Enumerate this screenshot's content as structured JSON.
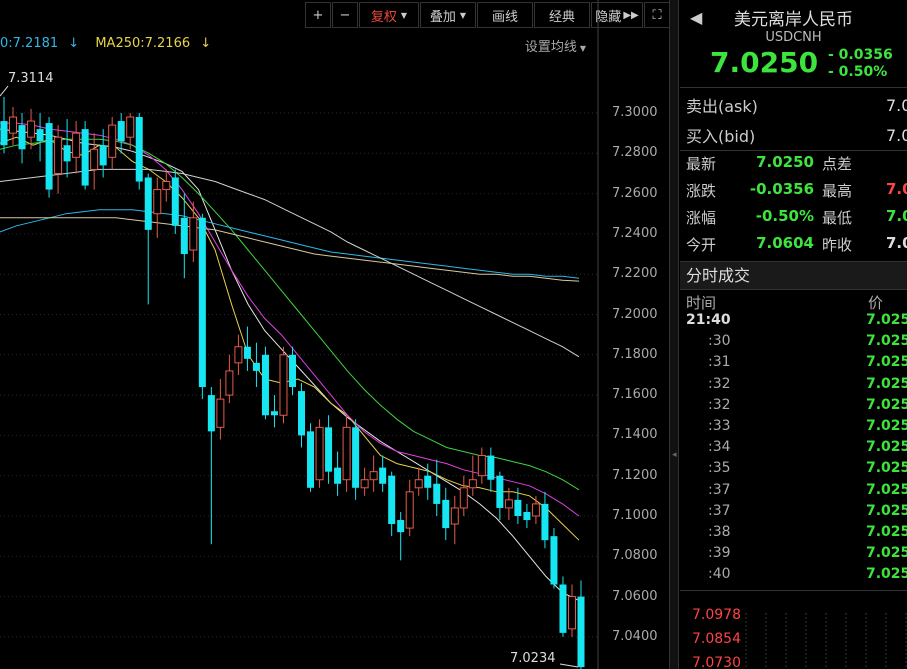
{
  "toolbar": {
    "zoom_in": "+",
    "zoom_out": "−",
    "restore_rights": "复权",
    "overlay": "叠加",
    "draw_line": "画线",
    "classic": "经典",
    "hide": "隐藏",
    "fullscreen_icon": "fullscreen-icon"
  },
  "ma_legend": {
    "partial": "0:7.2181",
    "ma250": "MA250:7.2166"
  },
  "ma_settings": "设置均线",
  "annotations": {
    "high_label": "7.3114",
    "low_label": "7.0234"
  },
  "price_axis": [
    "7.3000",
    "7.2800",
    "7.2600",
    "7.2400",
    "7.2200",
    "7.2000",
    "7.1800",
    "7.1600",
    "7.1400",
    "7.1200",
    "7.1000",
    "7.0800",
    "7.0600",
    "7.0400"
  ],
  "quote": {
    "name": "美元离岸人民币",
    "code": "USDCNH",
    "price": "7.0250",
    "change": "- 0.0356",
    "change_pct": "- 0.50%"
  },
  "askbid": {
    "ask_label": "卖出(ask)",
    "ask_value": "7.0",
    "bid_label": "买入(bid)",
    "bid_value": "7.0"
  },
  "stats": [
    {
      "label": "最新",
      "value": "7.0250",
      "label2": "点差",
      "value2": ""
    },
    {
      "label": "涨跌",
      "value": "-0.0356",
      "label2": "最高",
      "value2": "7.0"
    },
    {
      "label": "涨幅",
      "value": "-0.50%",
      "label2": "最低",
      "value2": "7.0"
    },
    {
      "label": "今开",
      "value": "7.0604",
      "label2": "昨收",
      "value2": "7.0"
    }
  ],
  "ticks": {
    "title": "分时成交",
    "col_time": "时间",
    "col_price": "价",
    "rows": [
      {
        "time": "21:40",
        "price": "7.025"
      },
      {
        "time": ":30",
        "price": "7.025"
      },
      {
        "time": ":31",
        "price": "7.025"
      },
      {
        "time": ":32",
        "price": "7.025"
      },
      {
        "time": ":32",
        "price": "7.025"
      },
      {
        "time": ":33",
        "price": "7.025"
      },
      {
        "time": ":34",
        "price": "7.025"
      },
      {
        "time": ":35",
        "price": "7.025"
      },
      {
        "time": ":37",
        "price": "7.025"
      },
      {
        "time": ":37",
        "price": "7.025"
      },
      {
        "time": ":38",
        "price": "7.025"
      },
      {
        "time": ":39",
        "price": "7.025"
      },
      {
        "time": ":40",
        "price": "7.025"
      }
    ]
  },
  "depth": [
    "7.0978",
    "7.0854",
    "7.0730"
  ],
  "chart_data": {
    "type": "candlestick",
    "y_range": [
      7.0234,
      7.3114
    ],
    "colors": {
      "up": "#e55b4b",
      "down": "#16e6f2",
      "ma_white": "#e6e6e6",
      "ma_yellow": "#e6d34a",
      "ma_magenta": "#e040e0",
      "ma_green": "#3fd33f",
      "ma_cyan": "#2fb7e8",
      "ma_pale": "#d8c8a0"
    },
    "candles": [
      {
        "o": 7.296,
        "c": 7.284,
        "h": 7.308,
        "l": 7.28
      },
      {
        "o": 7.29,
        "c": 7.298,
        "h": 7.303,
        "l": 7.284
      },
      {
        "o": 7.294,
        "c": 7.282,
        "h": 7.3,
        "l": 7.275
      },
      {
        "o": 7.288,
        "c": 7.296,
        "h": 7.302,
        "l": 7.282
      },
      {
        "o": 7.292,
        "c": 7.286,
        "h": 7.3,
        "l": 7.276
      },
      {
        "o": 7.295,
        "c": 7.262,
        "h": 7.298,
        "l": 7.258
      },
      {
        "o": 7.27,
        "c": 7.288,
        "h": 7.294,
        "l": 7.26
      },
      {
        "o": 7.284,
        "c": 7.276,
        "h": 7.297,
        "l": 7.268
      },
      {
        "o": 7.278,
        "c": 7.29,
        "h": 7.296,
        "l": 7.27
      },
      {
        "o": 7.292,
        "c": 7.264,
        "h": 7.296,
        "l": 7.262
      },
      {
        "o": 7.272,
        "c": 7.282,
        "h": 7.29,
        "l": 7.262
      },
      {
        "o": 7.284,
        "c": 7.274,
        "h": 7.292,
        "l": 7.268
      },
      {
        "o": 7.278,
        "c": 7.294,
        "h": 7.298,
        "l": 7.272
      },
      {
        "o": 7.296,
        "c": 7.286,
        "h": 7.3,
        "l": 7.28
      },
      {
        "o": 7.288,
        "c": 7.298,
        "h": 7.3,
        "l": 7.282
      },
      {
        "o": 7.298,
        "c": 7.266,
        "h": 7.3,
        "l": 7.262
      },
      {
        "o": 7.268,
        "c": 7.242,
        "h": 7.27,
        "l": 7.205
      },
      {
        "o": 7.25,
        "c": 7.262,
        "h": 7.268,
        "l": 7.238
      },
      {
        "o": 7.262,
        "c": 7.266,
        "h": 7.272,
        "l": 7.256
      },
      {
        "o": 7.268,
        "c": 7.244,
        "h": 7.272,
        "l": 7.24
      },
      {
        "o": 7.248,
        "c": 7.23,
        "h": 7.26,
        "l": 7.218
      },
      {
        "o": 7.232,
        "c": 7.248,
        "h": 7.256,
        "l": 7.226
      },
      {
        "o": 7.248,
        "c": 7.164,
        "h": 7.25,
        "l": 7.158
      },
      {
        "o": 7.16,
        "c": 7.142,
        "h": 7.164,
        "l": 7.086
      },
      {
        "o": 7.144,
        "c": 7.158,
        "h": 7.168,
        "l": 7.138
      },
      {
        "o": 7.16,
        "c": 7.172,
        "h": 7.18,
        "l": 7.156
      },
      {
        "o": 7.176,
        "c": 7.184,
        "h": 7.19,
        "l": 7.17
      },
      {
        "o": 7.184,
        "c": 7.178,
        "h": 7.194,
        "l": 7.172
      },
      {
        "o": 7.176,
        "c": 7.172,
        "h": 7.186,
        "l": 7.164
      },
      {
        "o": 7.18,
        "c": 7.15,
        "h": 7.184,
        "l": 7.148
      },
      {
        "o": 7.152,
        "c": 7.15,
        "h": 7.16,
        "l": 7.144
      },
      {
        "o": 7.15,
        "c": 7.18,
        "h": 7.184,
        "l": 7.146
      },
      {
        "o": 7.18,
        "c": 7.164,
        "h": 7.184,
        "l": 7.16
      },
      {
        "o": 7.162,
        "c": 7.14,
        "h": 7.166,
        "l": 7.134
      },
      {
        "o": 7.142,
        "c": 7.114,
        "h": 7.146,
        "l": 7.112
      },
      {
        "o": 7.118,
        "c": 7.144,
        "h": 7.148,
        "l": 7.114
      },
      {
        "o": 7.144,
        "c": 7.122,
        "h": 7.15,
        "l": 7.116
      },
      {
        "o": 7.124,
        "c": 7.116,
        "h": 7.132,
        "l": 7.11
      },
      {
        "o": 7.118,
        "c": 7.144,
        "h": 7.15,
        "l": 7.112
      },
      {
        "o": 7.144,
        "c": 7.114,
        "h": 7.148,
        "l": 7.108
      },
      {
        "o": 7.114,
        "c": 7.118,
        "h": 7.124,
        "l": 7.11
      },
      {
        "o": 7.118,
        "c": 7.122,
        "h": 7.13,
        "l": 7.112
      },
      {
        "o": 7.124,
        "c": 7.116,
        "h": 7.13,
        "l": 7.112
      },
      {
        "o": 7.12,
        "c": 7.096,
        "h": 7.122,
        "l": 7.09
      },
      {
        "o": 7.098,
        "c": 7.092,
        "h": 7.102,
        "l": 7.078
      },
      {
        "o": 7.094,
        "c": 7.112,
        "h": 7.118,
        "l": 7.09
      },
      {
        "o": 7.114,
        "c": 7.118,
        "h": 7.124,
        "l": 7.11
      },
      {
        "o": 7.12,
        "c": 7.114,
        "h": 7.126,
        "l": 7.108
      },
      {
        "o": 7.116,
        "c": 7.106,
        "h": 7.128,
        "l": 7.1
      },
      {
        "o": 7.108,
        "c": 7.094,
        "h": 7.114,
        "l": 7.088
      },
      {
        "o": 7.096,
        "c": 7.104,
        "h": 7.11,
        "l": 7.086
      },
      {
        "o": 7.104,
        "c": 7.114,
        "h": 7.12,
        "l": 7.1
      },
      {
        "o": 7.114,
        "c": 7.118,
        "h": 7.13,
        "l": 7.11
      },
      {
        "o": 7.12,
        "c": 7.13,
        "h": 7.134,
        "l": 7.116
      },
      {
        "o": 7.13,
        "c": 7.118,
        "h": 7.134,
        "l": 7.112
      },
      {
        "o": 7.12,
        "c": 7.104,
        "h": 7.122,
        "l": 7.098
      },
      {
        "o": 7.104,
        "c": 7.108,
        "h": 7.114,
        "l": 7.098
      },
      {
        "o": 7.108,
        "c": 7.1,
        "h": 7.114,
        "l": 7.096
      },
      {
        "o": 7.102,
        "c": 7.098,
        "h": 7.106,
        "l": 7.094
      },
      {
        "o": 7.1,
        "c": 7.106,
        "h": 7.11,
        "l": 7.096
      },
      {
        "o": 7.106,
        "c": 7.088,
        "h": 7.112,
        "l": 7.084
      },
      {
        "o": 7.09,
        "c": 7.066,
        "h": 7.094,
        "l": 7.064
      },
      {
        "o": 7.066,
        "c": 7.042,
        "h": 7.07,
        "l": 7.04
      },
      {
        "o": 7.044,
        "c": 7.06,
        "h": 7.066,
        "l": 7.04
      },
      {
        "o": 7.06,
        "c": 7.025,
        "h": 7.068,
        "l": 7.0234
      }
    ],
    "ma_lines": [
      {
        "name": "ma-white",
        "color": "#e6e6e6",
        "points": [
          7.292,
          7.291,
          7.29,
          7.289,
          7.287,
          7.285,
          7.284,
          7.283,
          7.281,
          7.278,
          7.275,
          7.271,
          7.262,
          7.242,
          7.222,
          7.205,
          7.192,
          7.183,
          7.174,
          7.165,
          7.156,
          7.149,
          7.143,
          7.137,
          7.132,
          7.127,
          7.122,
          7.117,
          7.112,
          7.106,
          7.099,
          7.09,
          7.08,
          7.07,
          7.062,
          7.058
        ]
      },
      {
        "name": "ma-yellow",
        "color": "#e6d34a",
        "points": [
          7.285,
          7.288,
          7.284,
          7.287,
          7.281,
          7.279,
          7.284,
          7.283,
          7.276,
          7.272,
          7.266,
          7.258,
          7.248,
          7.232,
          7.205,
          7.18,
          7.168,
          7.166,
          7.168,
          7.164,
          7.156,
          7.15,
          7.14,
          7.13,
          7.126,
          7.124,
          7.122,
          7.118,
          7.115,
          7.114,
          7.112,
          7.112,
          7.11,
          7.104,
          7.096,
          7.088
        ]
      },
      {
        "name": "ma-magenta",
        "color": "#e040e0",
        "points": [
          7.295,
          7.295,
          7.294,
          7.292,
          7.291,
          7.29,
          7.289,
          7.287,
          7.284,
          7.279,
          7.272,
          7.262,
          7.25,
          7.236,
          7.222,
          7.209,
          7.198,
          7.19,
          7.18,
          7.17,
          7.16,
          7.15,
          7.142,
          7.136,
          7.132,
          7.13,
          7.128,
          7.126,
          7.123,
          7.121,
          7.119,
          7.117,
          7.115,
          7.111,
          7.106,
          7.1
        ]
      },
      {
        "name": "ma-green",
        "color": "#3fd33f",
        "points": [
          7.282,
          7.284,
          7.285,
          7.286,
          7.287,
          7.287,
          7.287,
          7.286,
          7.284,
          7.28,
          7.275,
          7.268,
          7.26,
          7.251,
          7.242,
          7.232,
          7.222,
          7.212,
          7.202,
          7.192,
          7.182,
          7.172,
          7.163,
          7.155,
          7.148,
          7.142,
          7.138,
          7.134,
          7.132,
          7.13,
          7.129,
          7.127,
          7.125,
          7.122,
          7.118,
          7.113
        ]
      },
      {
        "name": "ma-cyan",
        "color": "#2fb7e8",
        "points": [
          7.241,
          7.244,
          7.246,
          7.248,
          7.25,
          7.251,
          7.252,
          7.252,
          7.252,
          7.251,
          7.25,
          7.249,
          7.247,
          7.245,
          7.243,
          7.241,
          7.239,
          7.237,
          7.235,
          7.233,
          7.231,
          7.23,
          7.229,
          7.228,
          7.227,
          7.226,
          7.225,
          7.224,
          7.223,
          7.222,
          7.221,
          7.22,
          7.22,
          7.219,
          7.219,
          7.218
        ]
      },
      {
        "name": "ma-pale",
        "color": "#d8c8a0",
        "points": [
          7.248,
          7.248,
          7.248,
          7.248,
          7.248,
          7.248,
          7.248,
          7.248,
          7.247,
          7.246,
          7.245,
          7.244,
          7.243,
          7.242,
          7.24,
          7.238,
          7.236,
          7.234,
          7.232,
          7.23,
          7.229,
          7.228,
          7.227,
          7.226,
          7.225,
          7.224,
          7.223,
          7.222,
          7.221,
          7.22,
          7.22,
          7.219,
          7.219,
          7.218,
          7.217,
          7.2166
        ]
      },
      {
        "name": "ma-white-long",
        "color": "#d0d0d0",
        "points": [
          7.266,
          7.267,
          7.268,
          7.269,
          7.27,
          7.271,
          7.272,
          7.272,
          7.272,
          7.272,
          7.271,
          7.27,
          7.268,
          7.266,
          7.263,
          7.26,
          7.257,
          7.253,
          7.249,
          7.245,
          7.241,
          7.236,
          7.232,
          7.228,
          7.224,
          7.22,
          7.216,
          7.212,
          7.208,
          7.204,
          7.2,
          7.196,
          7.192,
          7.188,
          7.184,
          7.179
        ]
      }
    ]
  }
}
